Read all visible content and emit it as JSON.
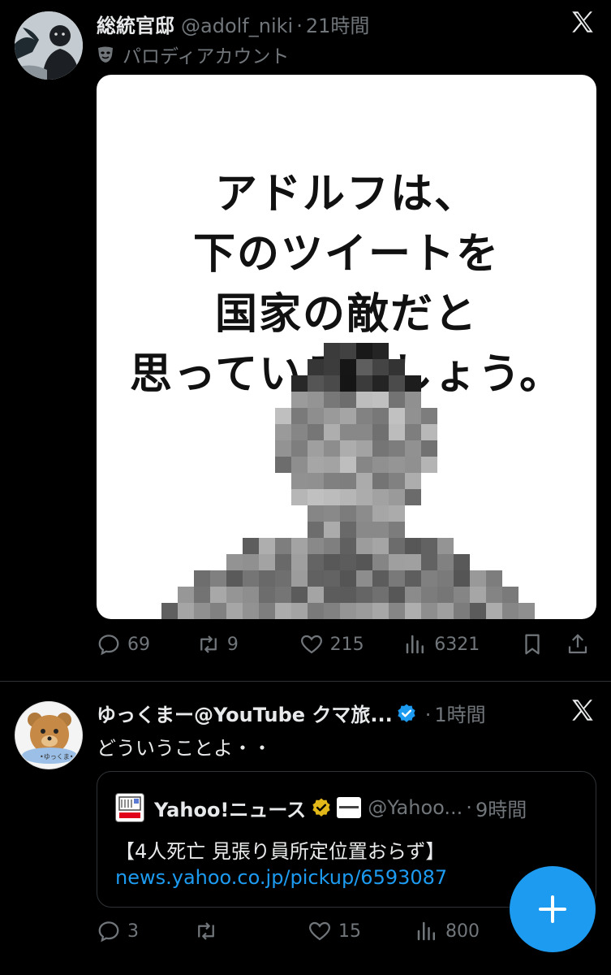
{
  "tweets": [
    {
      "display_name": "総統官邸",
      "handle": "@adolf_niki",
      "separator": "·",
      "time": "21時間",
      "parody_label": "パロディアカウント",
      "media_text": [
        "アドルフは、",
        "下のツイートを",
        "国家の敵だと",
        "思っているでしょう。"
      ],
      "actions": {
        "replies": "69",
        "retweets": "9",
        "likes": "215",
        "views": "6321"
      }
    },
    {
      "display_name": "ゆっくまー@YouTube クマ旅...",
      "separator": "·",
      "time": "1時間",
      "text": "どういうことよ・・",
      "quote": {
        "display_name": "Yahoo!ニュース",
        "handle": "@Yahoo...",
        "separator": "·",
        "time": "9時間",
        "text": "【4人死亡 見張り員所定位置おらず】",
        "link": "news.yahoo.co.jp/pickup/6593087"
      },
      "actions": {
        "replies": "3",
        "retweets": "",
        "likes": "15",
        "views": "800"
      }
    }
  ],
  "colors": {
    "background": "#000000",
    "text": "#e7e9ea",
    "muted": "#71767b",
    "accent": "#1d9bf0",
    "divider": "#2f3336"
  },
  "icons": [
    "x-logo-icon",
    "mask-icon",
    "reply-icon",
    "retweet-icon",
    "like-icon",
    "views-icon",
    "bookmark-icon",
    "share-icon",
    "verified-badge-icon",
    "plus-icon"
  ]
}
